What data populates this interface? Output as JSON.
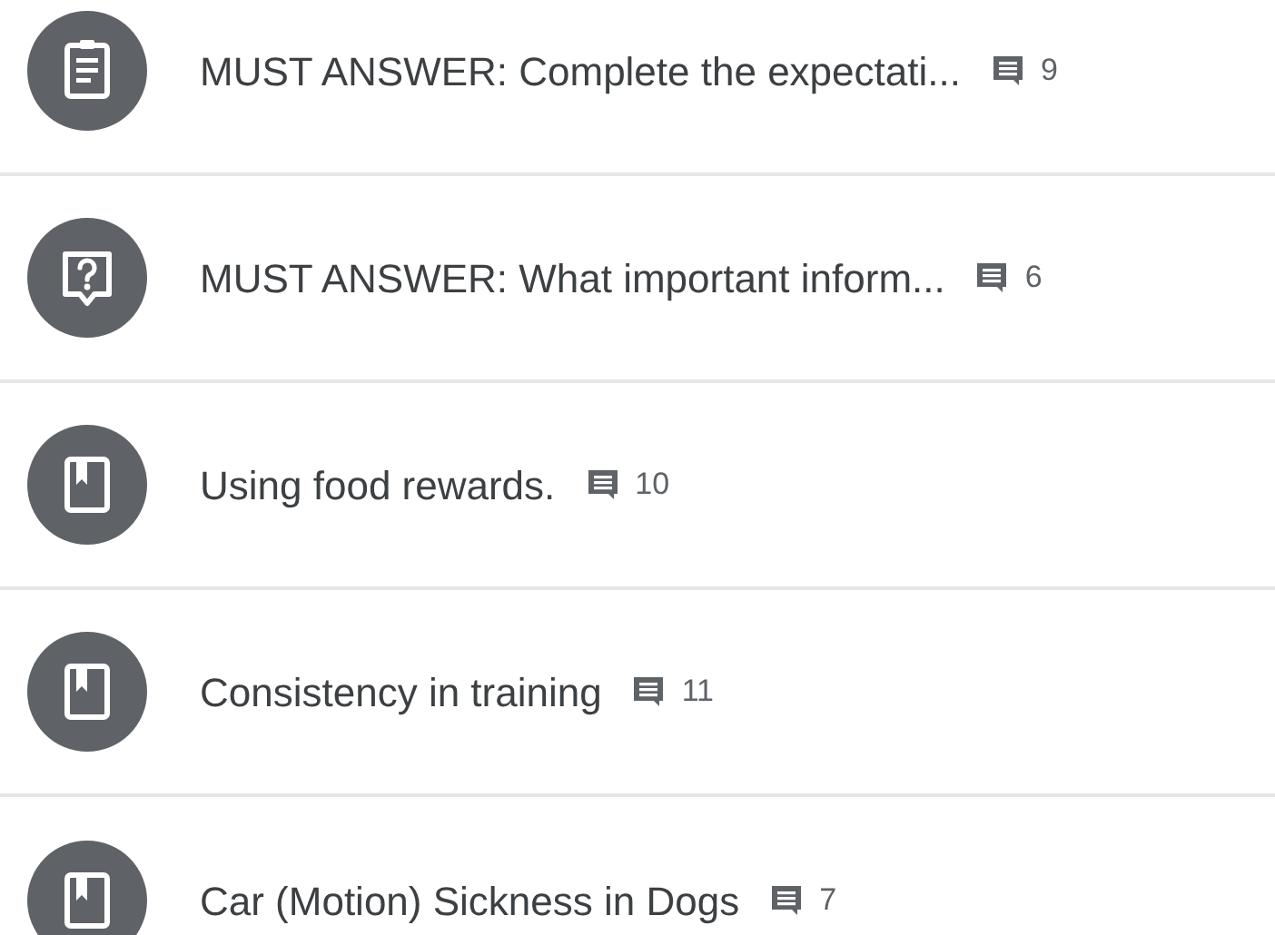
{
  "items": [
    {
      "kind": "material",
      "title": "MUST ANSWER: Complete the expectati...",
      "comments": "9"
    },
    {
      "kind": "question",
      "title": "MUST ANSWER: What important inform...",
      "comments": "6"
    },
    {
      "kind": "book",
      "title": "Using food rewards.",
      "comments": "10"
    },
    {
      "kind": "book",
      "title": "Consistency in training",
      "comments": "11"
    },
    {
      "kind": "book",
      "title": "Car (Motion) Sickness in Dogs",
      "comments": "7"
    }
  ]
}
